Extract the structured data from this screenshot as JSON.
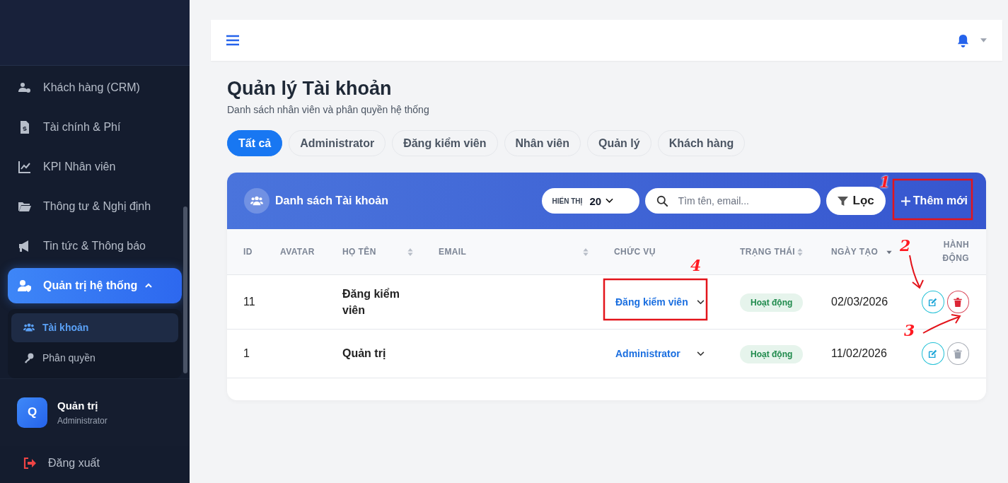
{
  "sidebar": {
    "items": [
      {
        "label": "Khách hàng (CRM)",
        "selected": false
      },
      {
        "label": "Tài chính & Phí",
        "selected": false
      },
      {
        "label": "KPI Nhân viên",
        "selected": false
      },
      {
        "label": "Thông tư & Nghị định",
        "selected": false
      },
      {
        "label": "Tin tức & Thông báo",
        "selected": false
      },
      {
        "label": "Quản trị hệ thống",
        "selected": true,
        "expanded": true,
        "children": [
          {
            "label": "Tài khoản",
            "selected": true
          },
          {
            "label": "Phân quyền",
            "selected": false
          }
        ]
      }
    ],
    "user": {
      "initial": "Q",
      "name": "Quản trị",
      "role": "Administrator"
    },
    "logout": "Đăng xuất"
  },
  "page": {
    "title": "Quản lý Tài khoản",
    "subtitle": "Danh sách nhân viên và phân quyền hệ thống"
  },
  "tabs": [
    {
      "label": "Tất cả",
      "selected": true
    },
    {
      "label": "Administrator",
      "selected": false
    },
    {
      "label": "Đăng kiểm viên",
      "selected": false
    },
    {
      "label": "Nhân viên",
      "selected": false
    },
    {
      "label": "Quản lý",
      "selected": false
    },
    {
      "label": "Khách hàng",
      "selected": false
    }
  ],
  "card": {
    "title": "Danh sách Tài khoản",
    "page_size": {
      "label": "HIỂN THỊ",
      "value": "20"
    },
    "search": {
      "placeholder": "Tìm tên, email..."
    },
    "filter_button": "Lọc",
    "add_button": "Thêm mới"
  },
  "table": {
    "columns": [
      {
        "label": "ID"
      },
      {
        "label": "AVATAR"
      },
      {
        "label": "HỌ TÊN",
        "sortable": true,
        "sorted": false
      },
      {
        "label": "EMAIL",
        "sortable": true,
        "sorted": false
      },
      {
        "label": "CHỨC VỤ"
      },
      {
        "label": "TRẠNG THÁI",
        "sortable": true,
        "sorted": false
      },
      {
        "label": "NGÀY TẠO",
        "sortable": true,
        "sorted": true
      },
      {
        "label": "HÀNH ĐỘNG"
      }
    ],
    "rows": [
      {
        "id": "11",
        "name": "Đăng kiểm viên",
        "role": "Đăng kiểm viên",
        "status": "Hoạt động",
        "created": "02/03/2026",
        "can_delete": true
      },
      {
        "id": "1",
        "name": "Quản trị",
        "role": "Administrator",
        "status": "Hoạt động",
        "created": "11/02/2026",
        "can_delete": false
      }
    ]
  },
  "annotations": [
    {
      "label": "1"
    },
    {
      "label": "2"
    },
    {
      "label": "3"
    },
    {
      "label": "4"
    }
  ]
}
